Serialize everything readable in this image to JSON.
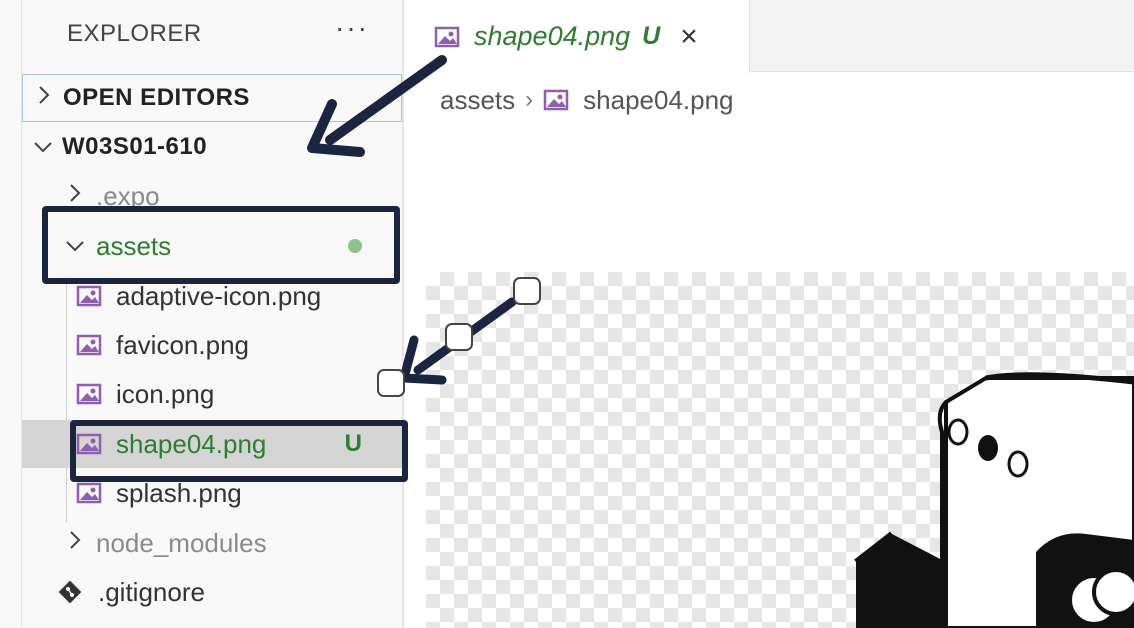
{
  "explorer": {
    "title": "EXPLORER",
    "more": "···"
  },
  "sections": {
    "open_editors": "OPEN EDITORS",
    "project": "W03S01-610"
  },
  "tree": {
    "expo": ".expo",
    "assets": "assets",
    "files": [
      {
        "name": "adaptive-icon.png"
      },
      {
        "name": "favicon.png"
      },
      {
        "name": "icon.png"
      },
      {
        "name": "shape04.png",
        "badge": "U"
      },
      {
        "name": "splash.png"
      }
    ],
    "node_modules": "node_modules",
    "gitignore": ".gitignore"
  },
  "tab": {
    "title": "shape04.png",
    "badge": "U",
    "close": "×"
  },
  "breadcrumb": {
    "folder": "assets",
    "separator": "›",
    "file": "shape04.png"
  },
  "colors": {
    "git_untracked": "#2e7d32",
    "annotation": "#1c2540",
    "image_icon": "#8e5fb0"
  }
}
